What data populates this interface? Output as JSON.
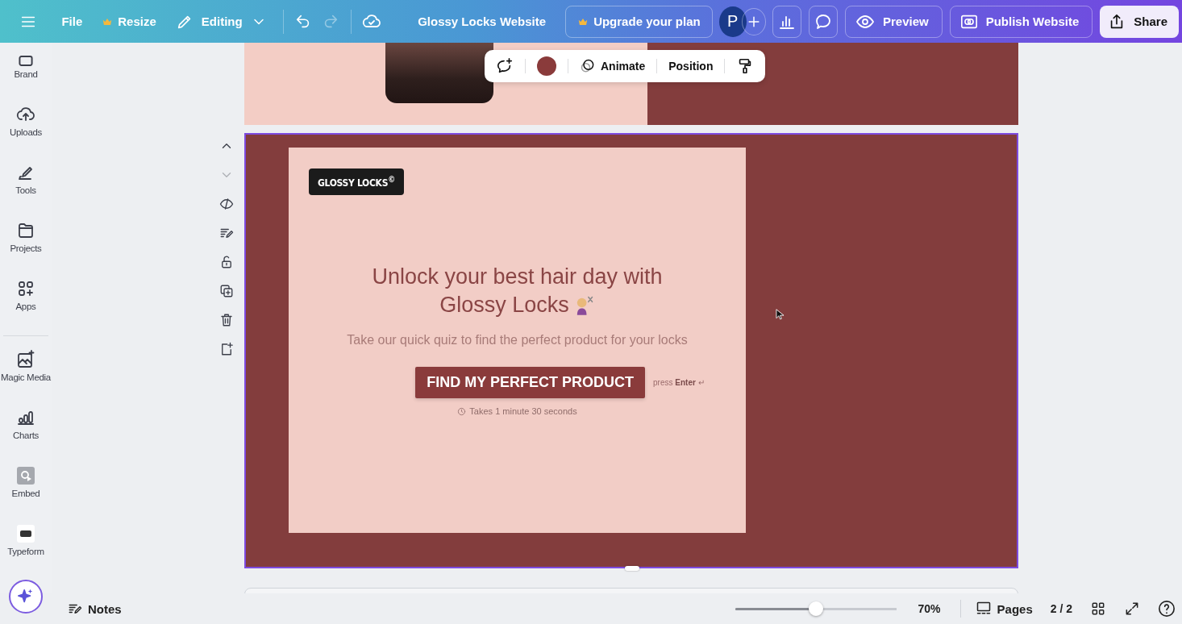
{
  "topbar": {
    "menu_items": [
      {
        "label": "File",
        "premium": false
      },
      {
        "label": "Resize",
        "premium": true
      }
    ],
    "mode": {
      "label": "Editing"
    },
    "undo": {
      "disabled": false
    },
    "redo": {
      "disabled": true
    },
    "title": "Glossy Locks Website",
    "upgrade": {
      "label": "Upgrade your plan",
      "premium": true
    },
    "avatar": {
      "initial": "P"
    },
    "actions": [
      {
        "label": "Preview",
        "kind": "outline"
      },
      {
        "label": "Publish Website",
        "kind": "outline"
      },
      {
        "label": "Share",
        "kind": "primary"
      }
    ]
  },
  "sidebar": {
    "groups": [
      {
        "items": [
          {
            "label": "Brand"
          },
          {
            "label": "Uploads"
          },
          {
            "label": "Tools"
          },
          {
            "label": "Projects"
          },
          {
            "label": "Apps"
          }
        ]
      },
      {
        "items": [
          {
            "label": "Magic Media"
          },
          {
            "label": "Charts"
          },
          {
            "label": "Embed"
          },
          {
            "label": "Typeform"
          }
        ]
      }
    ]
  },
  "canvas": {
    "pages": [
      {
        "selected": false
      },
      {
        "selected": true
      },
      {
        "selected": false
      }
    ],
    "float_toolbar": {
      "buttons": [
        {
          "label": "Animate"
        },
        {
          "label": "Position"
        }
      ]
    },
    "quiz": {
      "logo": "GLOSSY LOCKS$^{©}$",
      "heading_lines": [
        "Unlock your best hair day with",
        "Glossy Locks"
      ],
      "subtitle": "Take our quick quiz to find the perfect product for your locks",
      "cta": "FIND MY PERFECT PRODUCT",
      "hint": "press **Enter** ↵",
      "duration": "Takes 1 minute 30 seconds"
    }
  },
  "bottom_bar": {
    "notes": "Notes",
    "zoom": {
      "level": 0.5,
      "label": "70%"
    },
    "pages_label": "Pages",
    "page_counter": "2 / 2"
  }
}
